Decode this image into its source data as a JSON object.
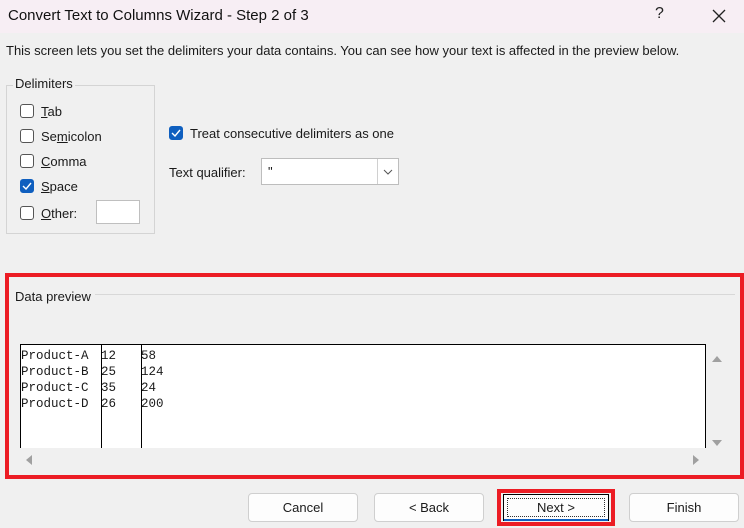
{
  "window": {
    "title": "Convert Text to Columns Wizard - Step 2 of 3",
    "help_label": "?",
    "close_icon": "close-icon"
  },
  "description": "This screen lets you set the delimiters your data contains.  You can see how your text is affected in the preview below.",
  "delimiters": {
    "group_label": "Delimiters",
    "items": [
      {
        "label": "Tab",
        "accel": "T",
        "checked": false
      },
      {
        "label": "Semicolon",
        "accel": "m",
        "checked": false
      },
      {
        "label": "Comma",
        "accel": "C",
        "checked": false
      },
      {
        "label": "Space",
        "accel": "S",
        "checked": true
      },
      {
        "label": "Other:",
        "accel": "O",
        "checked": false
      }
    ],
    "other_value": ""
  },
  "options": {
    "consecutive_label": "Treat consecutive delimiters as one",
    "consecutive_checked": true,
    "qualifier_label": "Text qualifier:",
    "qualifier_value": "\""
  },
  "preview": {
    "label": "Data preview",
    "rows": [
      [
        "Product-A",
        "12",
        "58"
      ],
      [
        "Product-B",
        "25",
        "124"
      ],
      [
        "Product-C",
        "35",
        "24"
      ],
      [
        "Product-D",
        "26",
        "200"
      ]
    ]
  },
  "buttons": {
    "cancel": "Cancel",
    "back": "< Back",
    "next": "Next >",
    "finish": "Finish"
  },
  "colors": {
    "accent": "#0f5fbf",
    "highlight": "#ec1c24",
    "titlebar": "#f7eef4",
    "dialog_bg": "#f0f0f0"
  }
}
